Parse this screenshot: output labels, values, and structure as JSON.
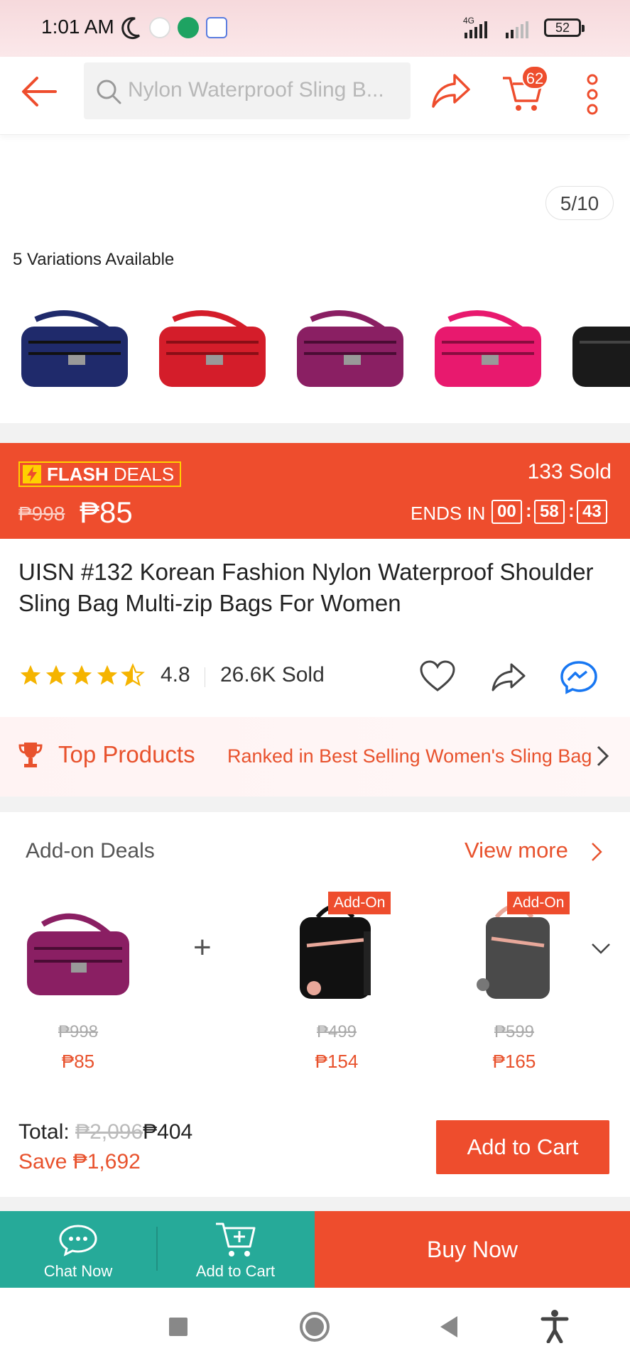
{
  "status_bar": {
    "time": "1:01 AM",
    "network": "4G",
    "battery": "52"
  },
  "header": {
    "search_placeholder": "Nylon Waterproof Sling B...",
    "cart_count": "62"
  },
  "gallery": {
    "page_counter": "5/10",
    "variations_label": "5 Variations Available",
    "variations": [
      {
        "color": "#1f2a6b"
      },
      {
        "color": "#d41d2a"
      },
      {
        "color": "#8a1f63"
      },
      {
        "color": "#e8196e"
      },
      {
        "color": "#1a1a1a"
      }
    ]
  },
  "flash_deal": {
    "badge_strong": "FLASH",
    "badge_rest": " DEALS",
    "sold": "133 Sold",
    "original_price": "₱998",
    "price": "₱85",
    "ends_label": "ENDS IN",
    "hours": "00",
    "minutes": "58",
    "seconds": "43"
  },
  "product": {
    "title": "UISN #132 Korean Fashion Nylon Waterproof Shoulder Sling Bag Multi-zip Bags For Women",
    "rating": "4.8",
    "stars_value": 4.5,
    "sold": "26.6K Sold"
  },
  "top_products": {
    "label": "Top Products",
    "ranking": "Ranked in Best Selling Women's Sling Bag"
  },
  "addon_deals": {
    "title": "Add-on Deals",
    "view_more": "View more",
    "plus": "+",
    "items": [
      {
        "badge": "",
        "old_price": "₱998",
        "price": "₱85",
        "color": "#8a1f63"
      },
      {
        "badge": "Add-On",
        "old_price": "₱499",
        "price": "₱154",
        "color": "#111111"
      },
      {
        "badge": "Add-On",
        "old_price": "₱599",
        "price": "₱165",
        "color": "#4a4a4a"
      }
    ],
    "total_label": "Total:",
    "total_old": "₱2,096",
    "total_new": "₱404",
    "save_label": "Save",
    "save_amount": "₱1,692",
    "add_to_cart": "Add to Cart"
  },
  "bottom_bar": {
    "chat_now": "Chat Now",
    "add_to_cart": "Add to Cart",
    "buy_now": "Buy Now"
  },
  "colors": {
    "brand": "#ee4d2d",
    "teal": "#26aa99",
    "star": "#f5b400"
  }
}
